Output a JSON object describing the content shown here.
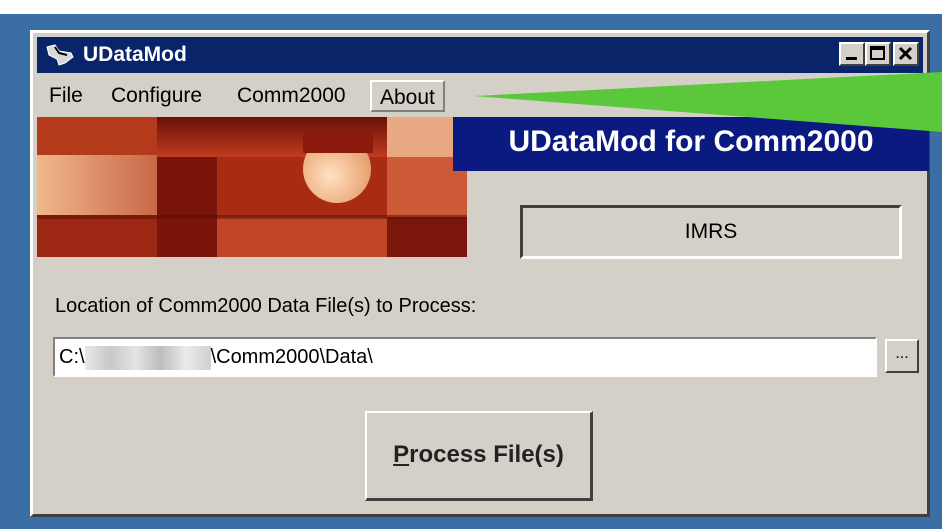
{
  "window": {
    "title": "UDataMod",
    "controls": [
      "minimize",
      "maximize",
      "close"
    ]
  },
  "menu": {
    "items": [
      "File",
      "Configure",
      "Comm2000",
      "About"
    ],
    "active": "About"
  },
  "banner": {
    "title": "UDataMod for Comm2000"
  },
  "module_display": {
    "value": "IMRS"
  },
  "location": {
    "label": "Location of Comm2000 Data File(s) to Process:",
    "path_prefix": "C:\\",
    "path_suffix": "\\Comm2000\\Data\\",
    "browse_label": "..."
  },
  "process_button": {
    "accel": "P",
    "rest": "rocess File(s)"
  },
  "colors": {
    "titlebar": "#0a246a",
    "banner": "#0a1a80",
    "window_face": "#d4d0c8",
    "desktop": "#3a6ea5",
    "pointer": "#5ac83a"
  }
}
